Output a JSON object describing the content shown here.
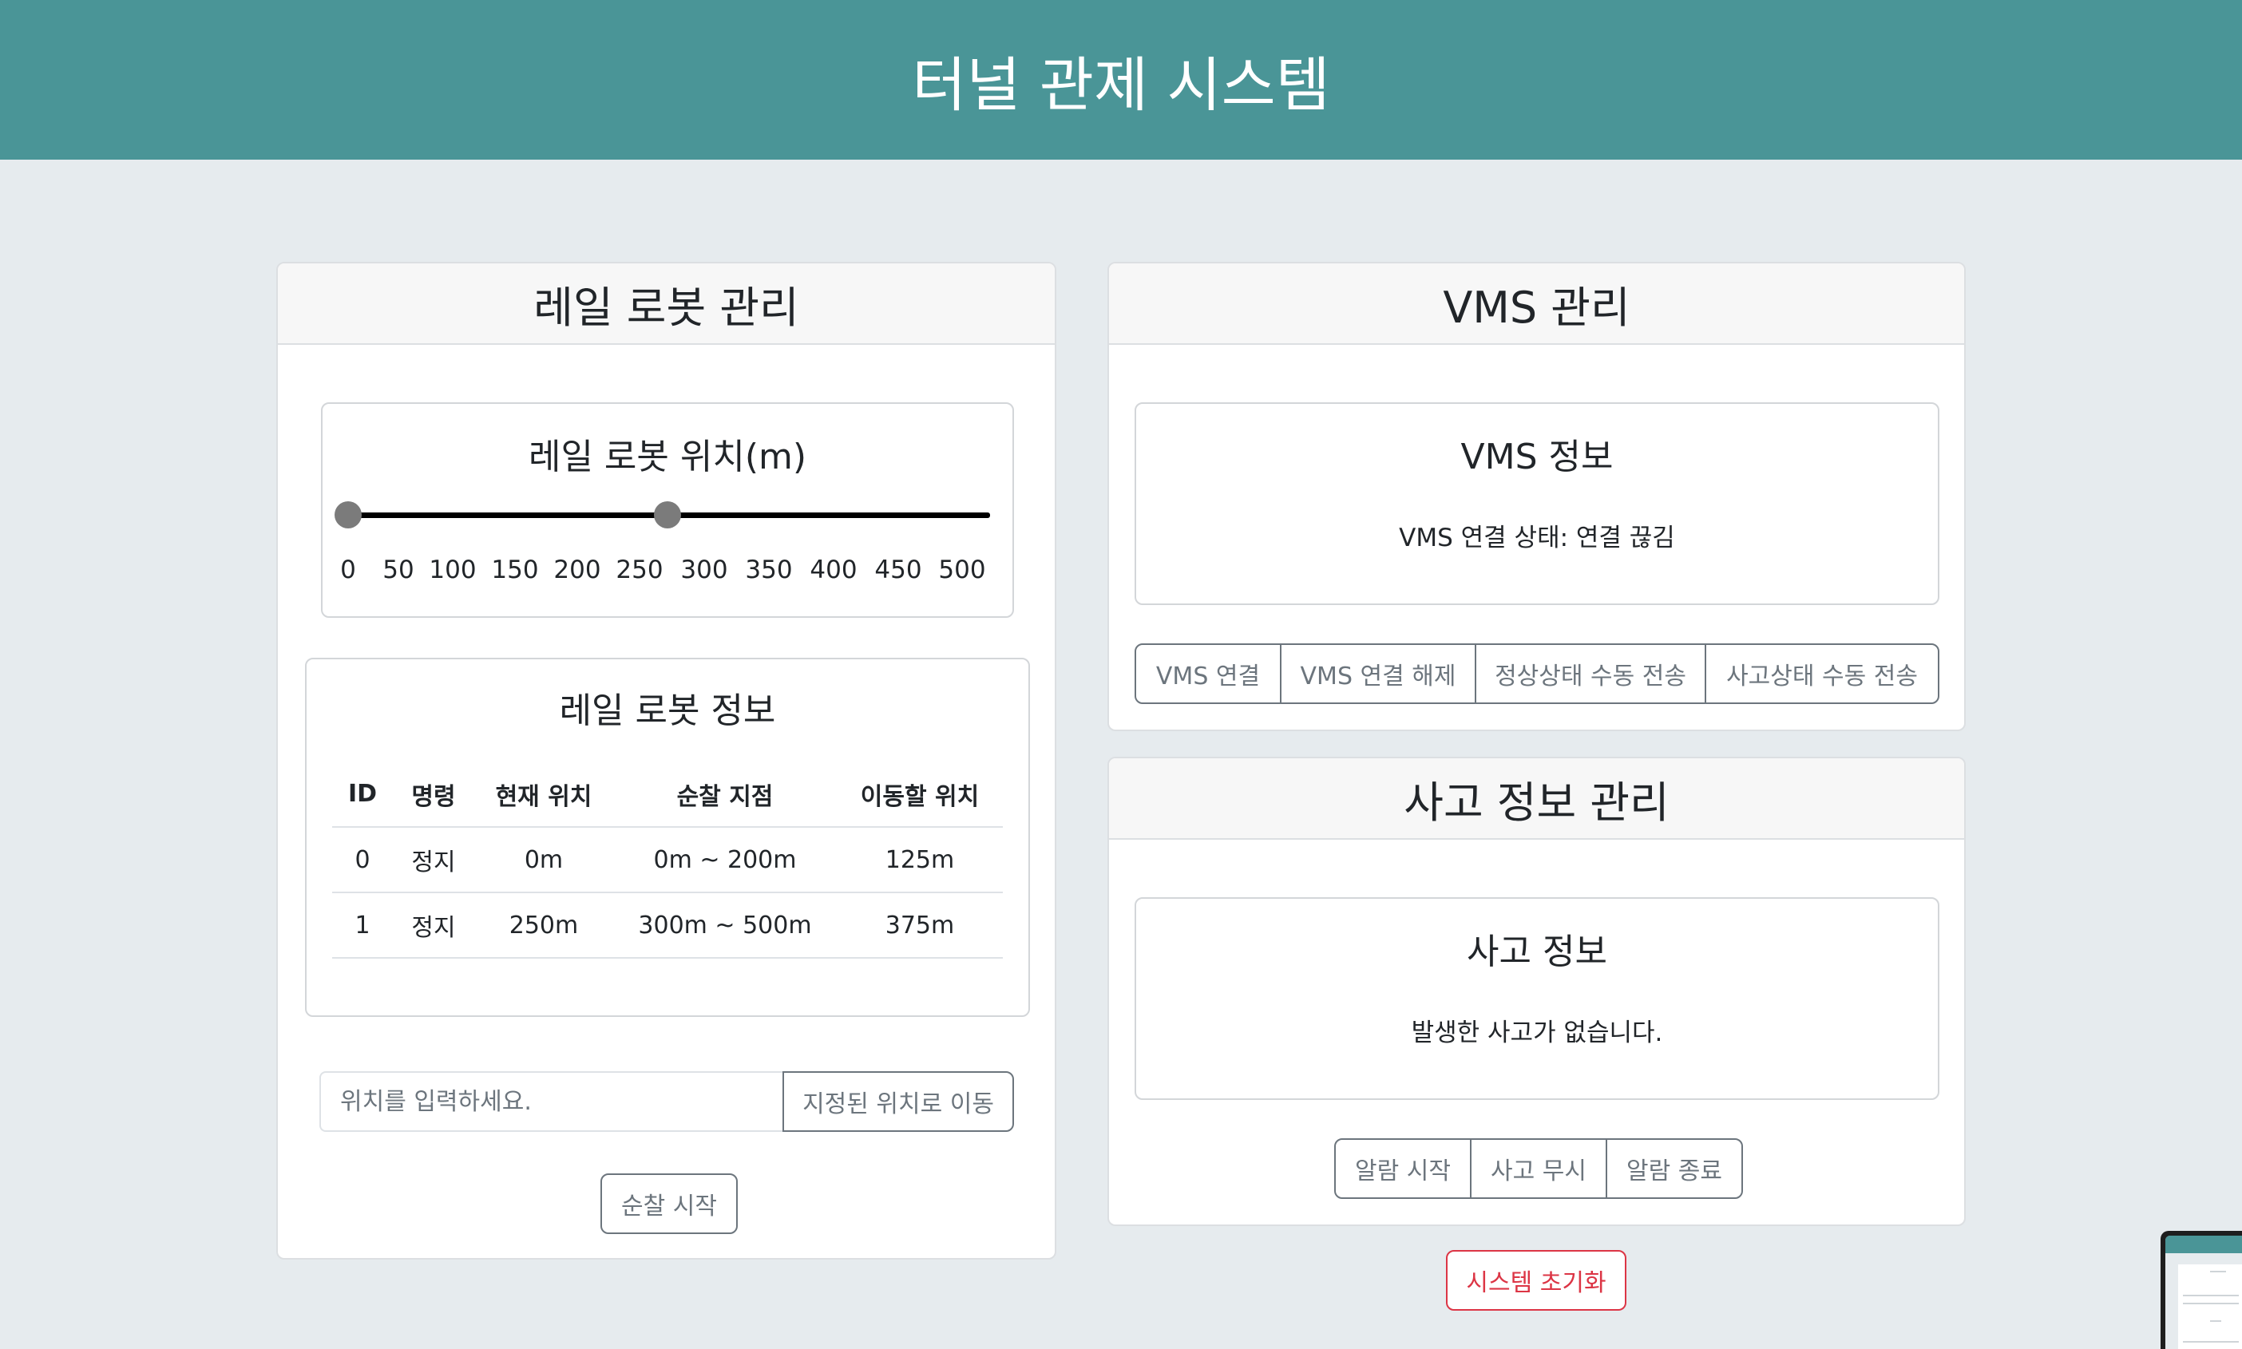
{
  "app": {
    "title": "터널 관제 시스템"
  },
  "rail_robot": {
    "header": "레일 로봇 관리",
    "position_panel": {
      "title": "레일 로봇 위치(m)",
      "ticks": [
        "0",
        "50",
        "100",
        "150",
        "200",
        "250",
        "300",
        "350",
        "400",
        "450",
        "500"
      ],
      "robot_positions_m": [
        0,
        250
      ]
    },
    "info_panel": {
      "title": "레일 로봇 정보",
      "columns": [
        "ID",
        "명령",
        "현재 위치",
        "순찰 지점",
        "이동할 위치"
      ],
      "rows": [
        [
          "0",
          "정지",
          "0m",
          "0m ~ 200m",
          "125m"
        ],
        [
          "1",
          "정지",
          "250m",
          "300m ~ 500m",
          "375m"
        ]
      ]
    },
    "position_input": {
      "placeholder": "위치를 입력하세요.",
      "value": ""
    },
    "move_button": "지정된 위치로 이동",
    "patrol_button": "순찰 시작"
  },
  "vms": {
    "header": "VMS 관리",
    "info_title": "VMS 정보",
    "status_text": "VMS 연결 상태: 연결 끊김",
    "buttons": [
      "VMS 연결",
      "VMS 연결 해제",
      "정상상태 수동 전송",
      "사고상태 수동 전송"
    ]
  },
  "accident": {
    "header": "사고 정보 관리",
    "info_title": "사고 정보",
    "status_text": "발생한 사고가 없습니다.",
    "buttons": [
      "알람 시작",
      "사고 무시",
      "알람 종료"
    ]
  },
  "system_reset_button": "시스템 초기화",
  "colors": {
    "header_bg": "#4a9597",
    "page_bg": "#e6ebee",
    "danger": "#dc3545",
    "secondary": "#6c757d"
  }
}
